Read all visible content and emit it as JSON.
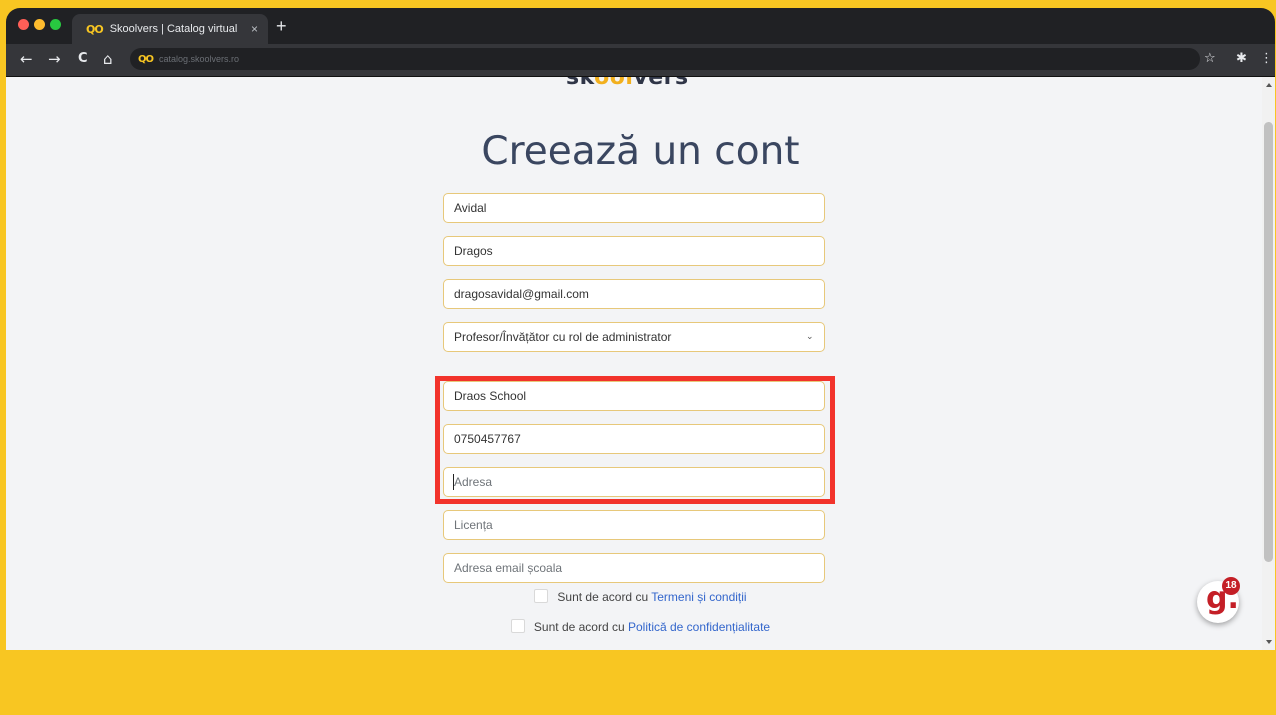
{
  "browser": {
    "tab_title": "Skoolvers | Catalog virtual",
    "favicon_text": "QO",
    "tab_close": "×",
    "new_tab": "+",
    "url": "catalog.skoolvers.ro",
    "nav": {
      "back": "←",
      "forward": "→",
      "reload": "C",
      "home": "⌂"
    },
    "toolbar_right": {
      "star": "☆",
      "extensions": "✱",
      "menu": "⋮"
    }
  },
  "page": {
    "logo": {
      "part1": "sk",
      "part2": "ool",
      "part3": "vers"
    },
    "title": "Creează un cont",
    "fields": {
      "last_name": {
        "value": "Avidal",
        "placeholder": ""
      },
      "first_name": {
        "value": "Dragos",
        "placeholder": ""
      },
      "email": {
        "value": "dragosavidal@gmail.com",
        "placeholder": ""
      },
      "role": {
        "selected": "Profesor/Învățător cu rol de administrator"
      },
      "school": {
        "value": "Draos School",
        "placeholder": ""
      },
      "phone": {
        "value": "0750457767",
        "placeholder": ""
      },
      "address": {
        "value": "",
        "placeholder": "Adresa"
      },
      "license": {
        "value": "",
        "placeholder": "Licența"
      },
      "school_email": {
        "value": "",
        "placeholder": "Adresa email școala"
      }
    },
    "terms": {
      "prefix": "Sunt de acord cu ",
      "link": "Termeni și condiții"
    },
    "privacy": {
      "prefix": "Sunt de acord cu ",
      "link": "Politică de confidențialitate"
    },
    "chevron": "⌄",
    "badge": {
      "letter": "g.",
      "count": "18"
    }
  },
  "colors": {
    "brand_yellow": "#f8c622",
    "highlight_red": "#f2332b",
    "link_blue": "#3366cc",
    "title_color": "#3a4660"
  }
}
